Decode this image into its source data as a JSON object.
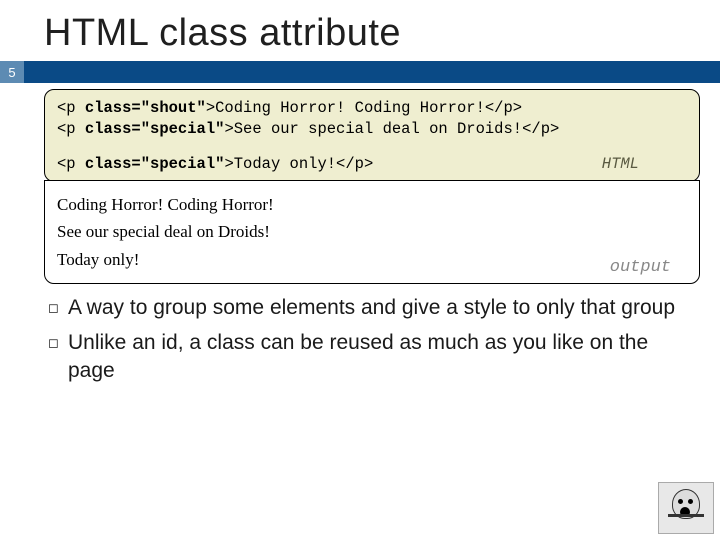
{
  "title": "HTML class attribute",
  "page_number": "5",
  "code": {
    "line1_pre": "<p ",
    "line1_kw": "class=\"shout\"",
    "line1_post": ">Coding Horror! Coding Horror!</p>",
    "line2_pre": "<p ",
    "line2_kw": "class=\"special\"",
    "line2_post": ">See our special deal on Droids!</p>",
    "blank": " ",
    "line3_pre": "<p ",
    "line3_kw": "class=\"special\"",
    "line3_post": ">Today only!</p>",
    "label": "HTML"
  },
  "output": {
    "line1": "Coding Horror! Coding Horror!",
    "line2": "See our special deal on Droids!",
    "line3": "Today only!",
    "label": "output"
  },
  "bullets": [
    "A way to group some elements and give a style to only that group",
    "Unlike an id, a class can be reused as much as you like on the page"
  ]
}
